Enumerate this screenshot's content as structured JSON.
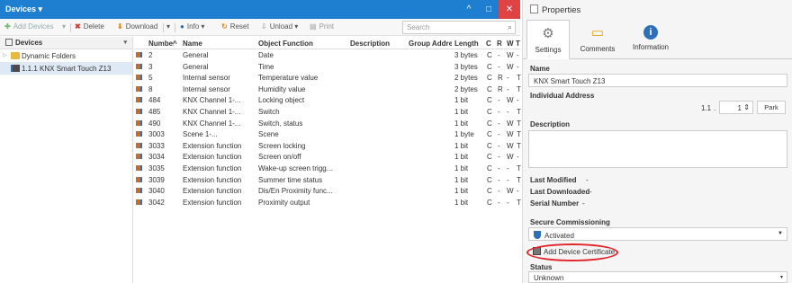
{
  "window": {
    "title": "Devices",
    "title_caret": "▾",
    "btn_caret_up": "^",
    "btn_restore": "□",
    "btn_close": "✕"
  },
  "toolbar": {
    "add_devices": "Add Devices",
    "delete": "Delete",
    "download": "Download",
    "info": "Info",
    "reset": "Reset",
    "unload": "Unload",
    "print": "Print",
    "search_placeholder": "Search",
    "dropdown_caret": "▾"
  },
  "tree": {
    "header": "Devices",
    "items": [
      {
        "label": "Dynamic Folders"
      },
      {
        "label": "1.1.1 KNX Smart Touch Z13"
      }
    ]
  },
  "grid": {
    "columns": [
      "Number",
      "Name",
      "Object Function",
      "Description",
      "Group Address",
      "Length",
      "C",
      "R",
      "W",
      "T"
    ],
    "sort_indicator": "^",
    "rows": [
      [
        "2",
        "General",
        "Date",
        "",
        "",
        "3 bytes",
        "C",
        "-",
        "W",
        "-"
      ],
      [
        "3",
        "General",
        "Time",
        "",
        "",
        "3 bytes",
        "C",
        "-",
        "W",
        "-"
      ],
      [
        "5",
        "Internal sensor",
        "Temperature value",
        "",
        "",
        "2 bytes",
        "C",
        "R",
        "-",
        "T"
      ],
      [
        "8",
        "Internal sensor",
        "Humidity value",
        "",
        "",
        "2 bytes",
        "C",
        "R",
        "-",
        "T"
      ],
      [
        "484",
        "KNX Channel 1-...",
        "Locking object",
        "",
        "",
        "1 bit",
        "C",
        "-",
        "W",
        "-"
      ],
      [
        "485",
        "KNX Channel 1-...",
        "Switch",
        "",
        "",
        "1 bit",
        "C",
        "-",
        "-",
        "T"
      ],
      [
        "490",
        "KNX Channel 1-...",
        "Switch, status",
        "",
        "",
        "1 bit",
        "C",
        "-",
        "W",
        "T"
      ],
      [
        "3003",
        "Scene 1-...",
        "Scene",
        "",
        "",
        "1 byte",
        "C",
        "-",
        "W",
        "T"
      ],
      [
        "3033",
        "Extension function",
        "Screen locking",
        "",
        "",
        "1 bit",
        "C",
        "-",
        "W",
        "T"
      ],
      [
        "3034",
        "Extension function",
        "Screen on/off",
        "",
        "",
        "1 bit",
        "C",
        "-",
        "W",
        "-"
      ],
      [
        "3035",
        "Extension function",
        "Wake-up screen trigg...",
        "",
        "",
        "1 bit",
        "C",
        "-",
        "-",
        "T"
      ],
      [
        "3039",
        "Extension function",
        "Summer time status",
        "",
        "",
        "1 bit",
        "C",
        "-",
        "-",
        "T"
      ],
      [
        "3040",
        "Extension function",
        "Dis/En Proximity func...",
        "",
        "",
        "1 bit",
        "C",
        "-",
        "W",
        "-"
      ],
      [
        "3042",
        "Extension function",
        "Proximity output",
        "",
        "",
        "1 bit",
        "C",
        "-",
        "-",
        "T"
      ]
    ]
  },
  "properties": {
    "title": "Properties",
    "tabs": [
      {
        "label": "Settings",
        "icon": "⚙"
      },
      {
        "label": "Comments",
        "icon": "▭"
      },
      {
        "label": "Information",
        "icon": "i"
      }
    ],
    "name_label": "Name",
    "name_value": "KNX Smart Touch Z13",
    "individual_address_label": "Individual Address",
    "address_prefix": "1.1",
    "address_dot": ".",
    "address_value": "1",
    "stepper_glyph": "⇕",
    "park_button": "Park",
    "description_label": "Description",
    "last_modified_label": "Last Modified",
    "last_modified_value": "-",
    "last_downloaded_label": "Last Downloaded",
    "last_downloaded_value": "-",
    "serial_number_label": "Serial Number",
    "serial_number_value": "-",
    "secure_commissioning_label": "Secure Commissioning",
    "secure_commissioning_value": "Activated",
    "add_device_certificate": "Add Device Certificate",
    "status_label": "Status",
    "status_value": "Unknown",
    "combo_arrow": "▼"
  },
  "colors": {
    "titlebar": "#1e7fd0",
    "close": "#e04343",
    "highlight_ring": "#e0262a"
  }
}
